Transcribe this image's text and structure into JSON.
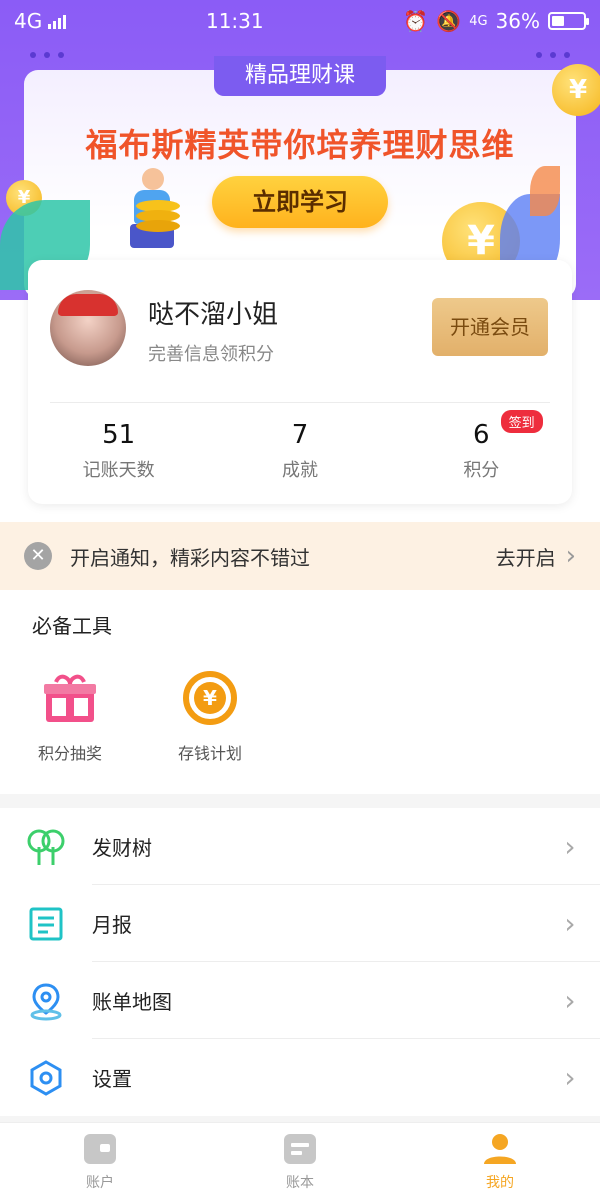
{
  "status_bar": {
    "network": "4G",
    "time": "11:31",
    "extra": "4G",
    "battery": "36%"
  },
  "banner": {
    "tab": "精品理财课",
    "headline": "福布斯精英带你培养理财思维",
    "cta": "立即学习",
    "coin_symbol": "¥"
  },
  "profile": {
    "name": "哒不溜小姐",
    "subtitle": "完善信息领积分",
    "vip_button": "开通会员",
    "stats": [
      {
        "value": "51",
        "label": "记账天数"
      },
      {
        "value": "7",
        "label": "成就"
      },
      {
        "value": "6",
        "label": "积分",
        "badge": "签到"
      }
    ]
  },
  "notice": {
    "text": "开启通知，精彩内容不错过",
    "action": "去开启"
  },
  "tools": {
    "title": "必备工具",
    "items": [
      {
        "label": "积分抽奖",
        "icon": "gift-icon",
        "color": "#f2508a"
      },
      {
        "label": "存钱计划",
        "icon": "yuan-coin-icon",
        "color": "#f39c12"
      }
    ]
  },
  "menu": [
    {
      "label": "发财树",
      "icon": "tree-icon",
      "color": "#3ccf6b"
    },
    {
      "label": "月报",
      "icon": "report-icon",
      "color": "#1fc3c6"
    },
    {
      "label": "账单地图",
      "icon": "map-pin-icon",
      "color": "#2d8ff2"
    },
    {
      "label": "设置",
      "icon": "settings-icon",
      "color": "#2d8ff2"
    }
  ],
  "bottom_nav": [
    {
      "label": "账户",
      "icon": "wallet-icon"
    },
    {
      "label": "账本",
      "icon": "ledger-icon"
    },
    {
      "label": "我的",
      "icon": "person-icon",
      "active": true
    }
  ],
  "colors": {
    "accent": "#f5a623",
    "header": "#8b5cf6",
    "badge": "#ee2d3d"
  }
}
